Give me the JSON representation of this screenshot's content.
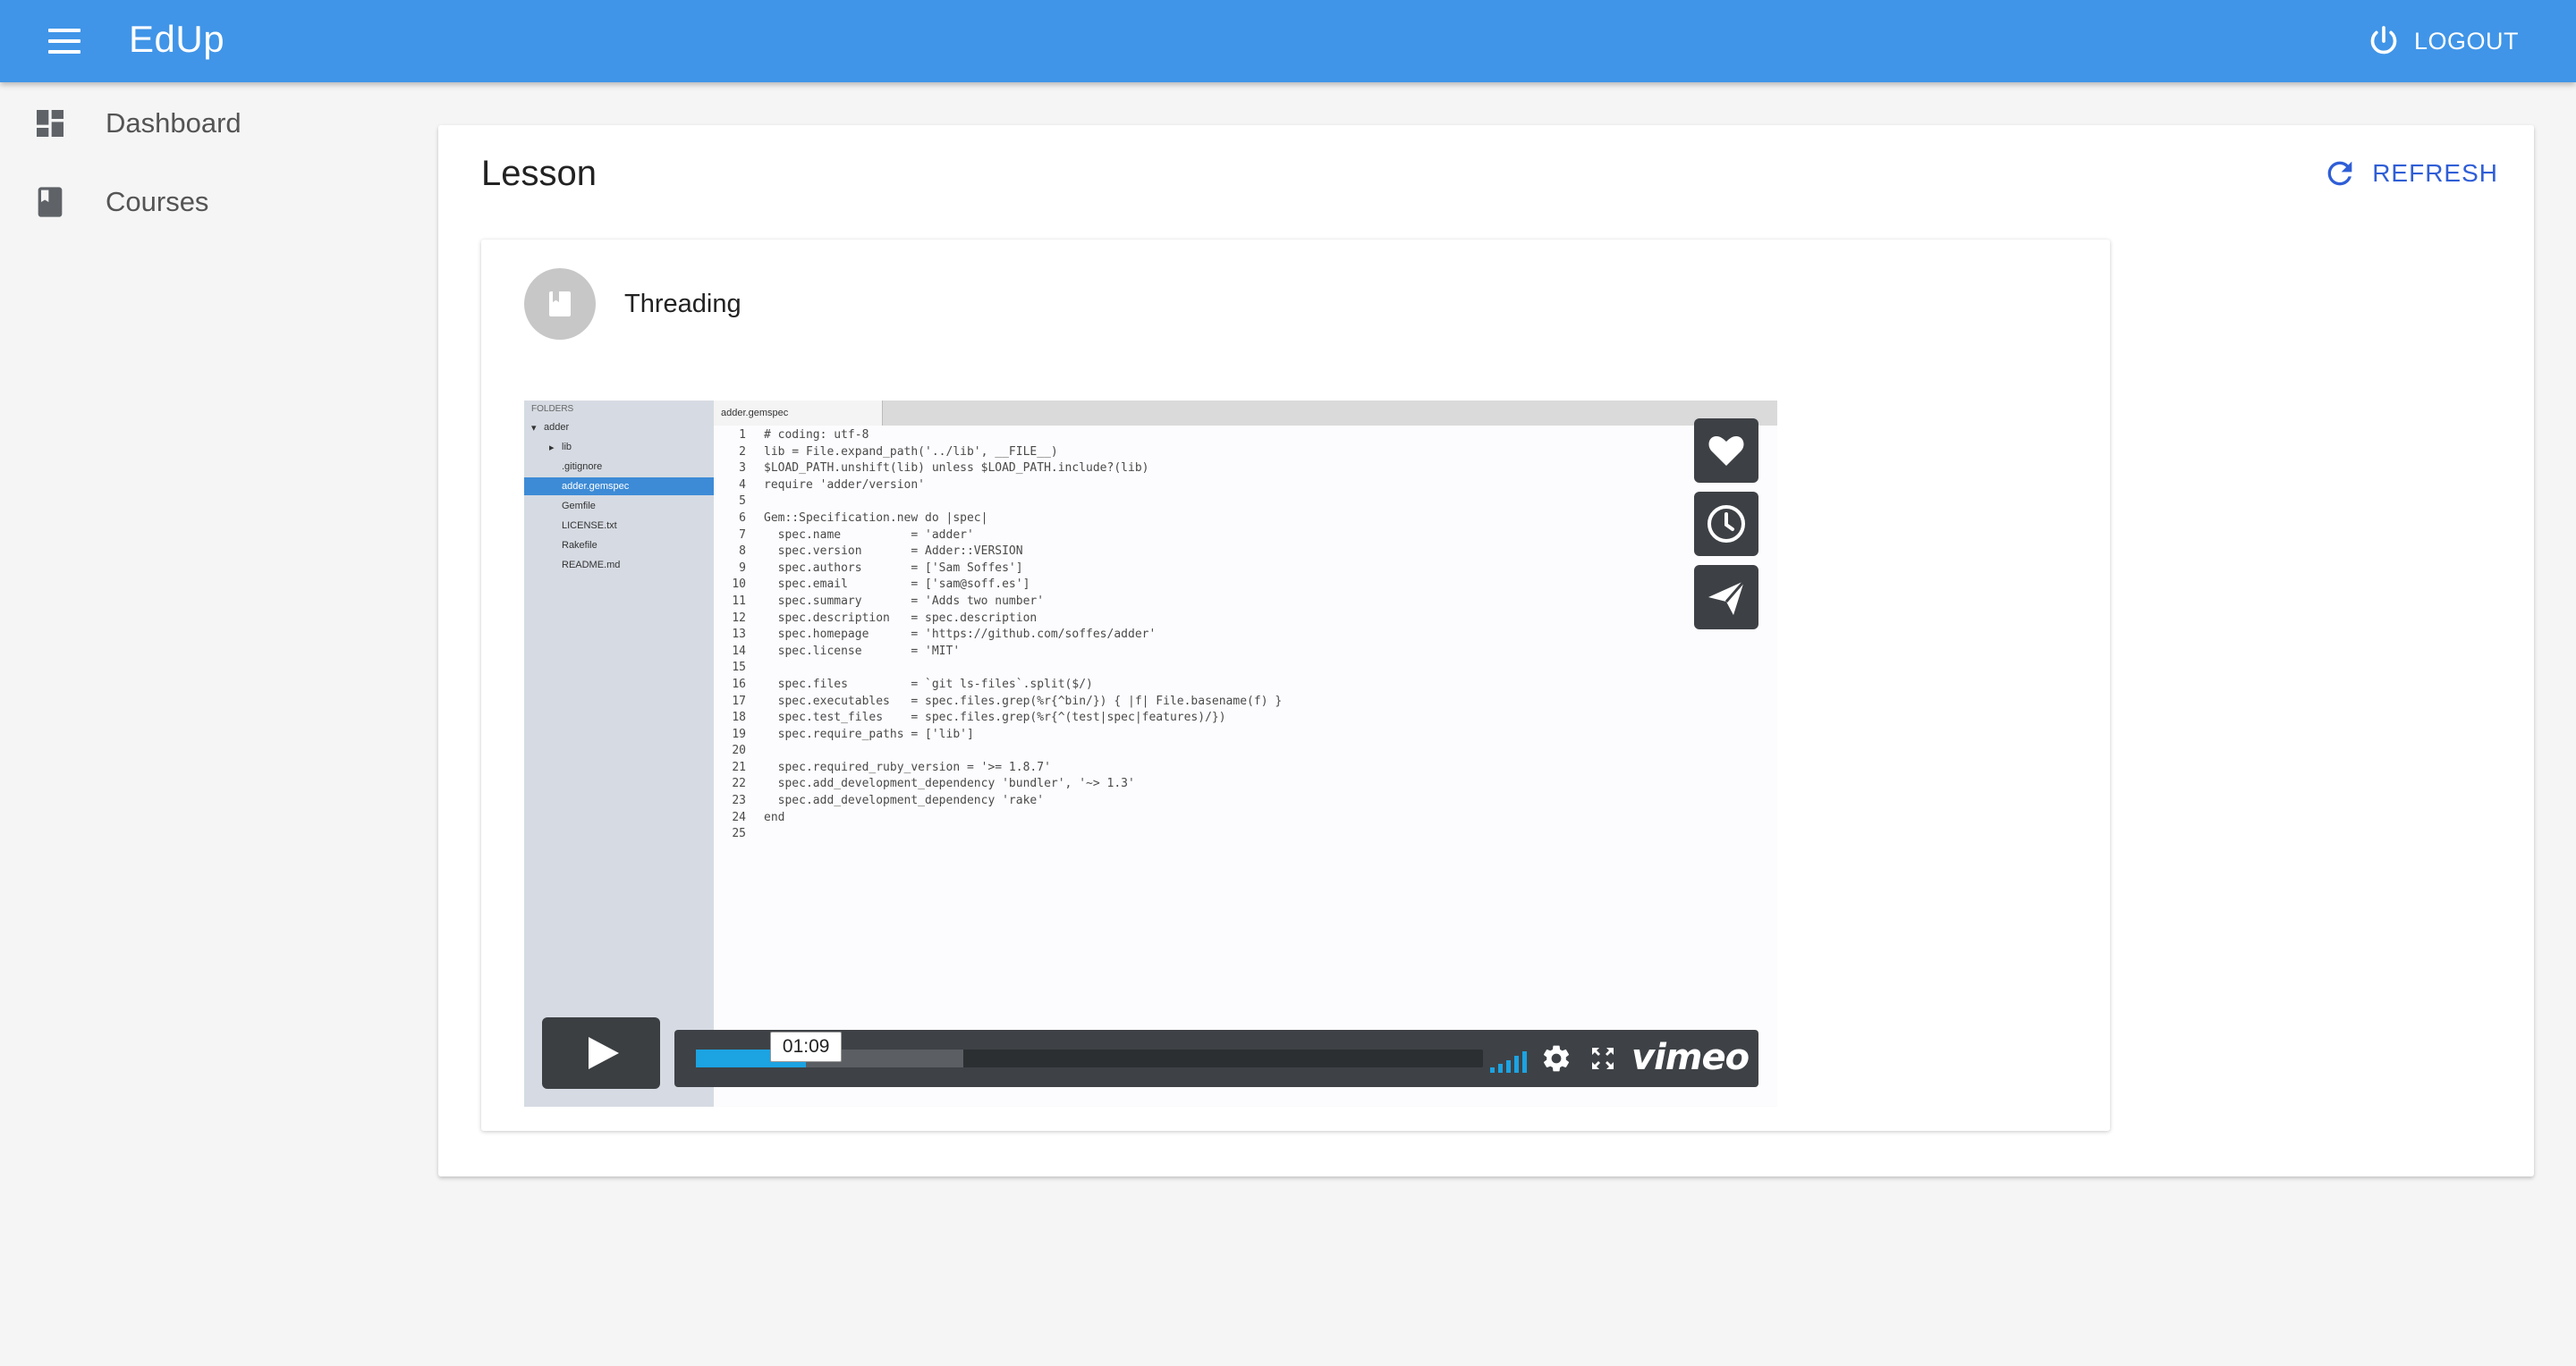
{
  "app": {
    "title": "EdUp",
    "logout_label": "LOGOUT"
  },
  "sidebar": {
    "items": [
      {
        "label": "Dashboard",
        "icon": "dashboard-icon"
      },
      {
        "label": "Courses",
        "icon": "book-icon"
      }
    ]
  },
  "main": {
    "title": "Lesson",
    "refresh_label": "REFRESH",
    "lesson": {
      "name": "Threading",
      "video": {
        "editor_sidebar": {
          "header": "FOLDERS",
          "items": [
            "adder",
            "lib",
            ".gitignore",
            "adder.gemspec",
            "Gemfile",
            "LICENSE.txt",
            "Rakefile",
            "README.md"
          ]
        },
        "tab_label": "adder.gemspec",
        "line_numbers": "1\n2\n3\n4\n5\n6\n7\n8\n9\n10\n11\n12\n13\n14\n15\n16\n17\n18\n19\n20\n21\n22\n23\n24\n25",
        "code": "# coding: utf-8\nlib = File.expand_path('../lib', __FILE__)\n$LOAD_PATH.unshift(lib) unless $LOAD_PATH.include?(lib)\nrequire 'adder/version'\n\nGem::Specification.new do |spec|\n  spec.name          = 'adder'\n  spec.version       = Adder::VERSION\n  spec.authors       = ['Sam Soffes']\n  spec.email         = ['sam@soff.es']\n  spec.summary       = 'Adds two number'\n  spec.description   = spec.description\n  spec.homepage      = 'https://github.com/soffes/adder'\n  spec.license       = 'MIT'\n\n  spec.files         = `git ls-files`.split($/)\n  spec.executables   = spec.files.grep(%r{^bin/}) { |f| File.basename(f) }\n  spec.test_files    = spec.files.grep(%r{^(test|spec|features)/})\n  spec.require_paths = ['lib']\n\n  spec.required_ruby_version = '>= 1.8.7'\n  spec.add_development_dependency 'bundler', '~> 1.3'\n  spec.add_development_dependency 'rake'\nend\n",
        "current_time": "01:09",
        "played_fraction": 0.14,
        "buffered_fraction": 0.34,
        "brand": "vimeo"
      }
    }
  },
  "colors": {
    "appbar": "#4095e8",
    "accent": "#2f5ed6",
    "progress": "#1ca3e2"
  }
}
